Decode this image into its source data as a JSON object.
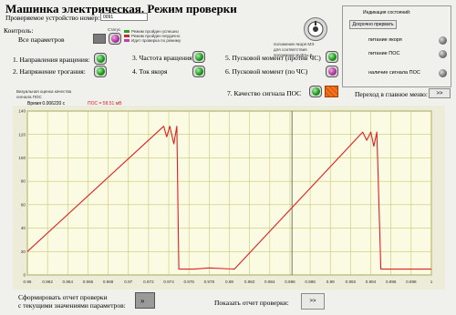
{
  "title": "Машинка электрическая. Режим проверки",
  "device": {
    "label": "Проверяемое устройство номер:",
    "value": "0091"
  },
  "control": {
    "label": "Контроль:",
    "all_params": "Все параметров",
    "status_label": "Статус"
  },
  "legend": [
    {
      "text": "Режим пройден успешно",
      "color": "#2aa02a"
    },
    {
      "text": "Режим пройден неудачно",
      "color": "#c03030"
    },
    {
      "text": "Идет проверка по режиму",
      "color": "#c040b0"
    }
  ],
  "checks": [
    {
      "label": "1. Направления вращения:",
      "state": "green"
    },
    {
      "label": "2. Напряжение трогания:",
      "state": "green"
    },
    {
      "label": "3. Частота вращения",
      "state": "green"
    },
    {
      "label": "4. Ток якоря",
      "state": "green"
    },
    {
      "label": "5. Пусковой момент (против ЧС)",
      "state": "green"
    },
    {
      "label": "6. Пусковой момент (по ЧС)",
      "state": "magenta"
    },
    {
      "label": "7. Качество сигнала ПОС",
      "state": "green"
    }
  ],
  "rotor_note": [
    "положение якоря МЭ",
    "для соответствия",
    "положение муфты 0"
  ],
  "indicator_panel": {
    "title": "Индикация состояний:",
    "early_button": "Досрочно прервать",
    "items": [
      "питание якоря",
      "питание ПОС",
      "наличие сигнала ПОС"
    ]
  },
  "goto_main": {
    "label": "Переход в главное меню:",
    "button": ">>"
  },
  "chart_note": [
    "Визуальная оценка качества",
    "сигнала ПОС"
  ],
  "readouts": {
    "time": "Время 0.006220 с",
    "pos": "ПОС = 58.51 мВ"
  },
  "bottom": {
    "report_label_1": "Сформировать отчет проверки",
    "report_label_2": "с текущими значениями параметров:",
    "show_label": "Показать отчет проверки:",
    "show_button": ">>"
  },
  "chart_data": {
    "type": "line",
    "title": "",
    "xlabel": "",
    "ylabel": "",
    "xlim": [
      0.96,
      1.0
    ],
    "ylim": [
      0,
      140
    ],
    "x_ticks": [
      "0.96",
      "0.962",
      "0.964",
      "0.966",
      "0.968",
      "0.97",
      "0.972",
      "0.974",
      "0.976",
      "0.978",
      "0.98",
      "0.982",
      "0.984",
      "0.986",
      "0.988",
      "0.99",
      "0.992",
      "0.994",
      "0.996",
      "0.998",
      "1"
    ],
    "y_ticks": [
      "0",
      "20",
      "40",
      "60",
      "80",
      "100",
      "120",
      "140"
    ],
    "grid": true,
    "cursor_x": 0.9862,
    "series": [
      {
        "name": "",
        "color": "#e02020",
        "x": [
          0.96,
          0.9735,
          0.9738,
          0.9741,
          0.9745,
          0.9748,
          0.975,
          0.9765,
          0.978,
          0.9805,
          0.9932,
          0.9936,
          0.994,
          0.9943,
          0.9946,
          0.995,
          1.0
        ],
        "y": [
          20,
          127,
          118,
          127,
          112,
          127,
          5,
          5,
          6,
          5,
          122,
          115,
          122,
          110,
          122,
          5,
          5
        ]
      }
    ]
  }
}
